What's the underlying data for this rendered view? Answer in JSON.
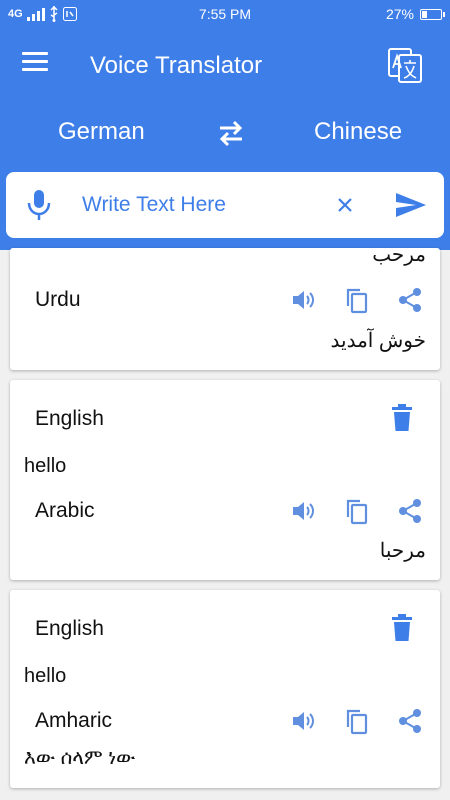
{
  "status_bar": {
    "network": "4G",
    "time": "7:55 PM",
    "battery_percent": "27%",
    "battery_level": 0.27,
    "icons": [
      "signal-icon",
      "usb-icon",
      "notification-icon",
      "battery-icon"
    ]
  },
  "app_bar": {
    "title": "Voice Translator",
    "menu_icon": "menu-icon",
    "action_icon": "translate-icon"
  },
  "language_bar": {
    "source": "German",
    "target": "Chinese",
    "swap_icon": "swap-icon"
  },
  "input": {
    "placeholder": "Write Text Here",
    "value": "",
    "mic_icon": "mic-icon",
    "clear_icon": "close-icon",
    "send_icon": "send-icon"
  },
  "colors": {
    "primary": "#3e7ee8",
    "action_icon": "#5f8fde",
    "background": "#f0f0f0"
  },
  "history": [
    {
      "source_lang": "",
      "source_text": "مرحب",
      "target_lang": "Urdu",
      "target_text": "خوش آمدید"
    },
    {
      "source_lang": "English",
      "source_text": "hello",
      "target_lang": "Arabic",
      "target_text": "مرحبا"
    },
    {
      "source_lang": "English",
      "source_text": "hello",
      "target_lang": "Amharic",
      "target_text": "እው ሰላም ነው"
    }
  ]
}
